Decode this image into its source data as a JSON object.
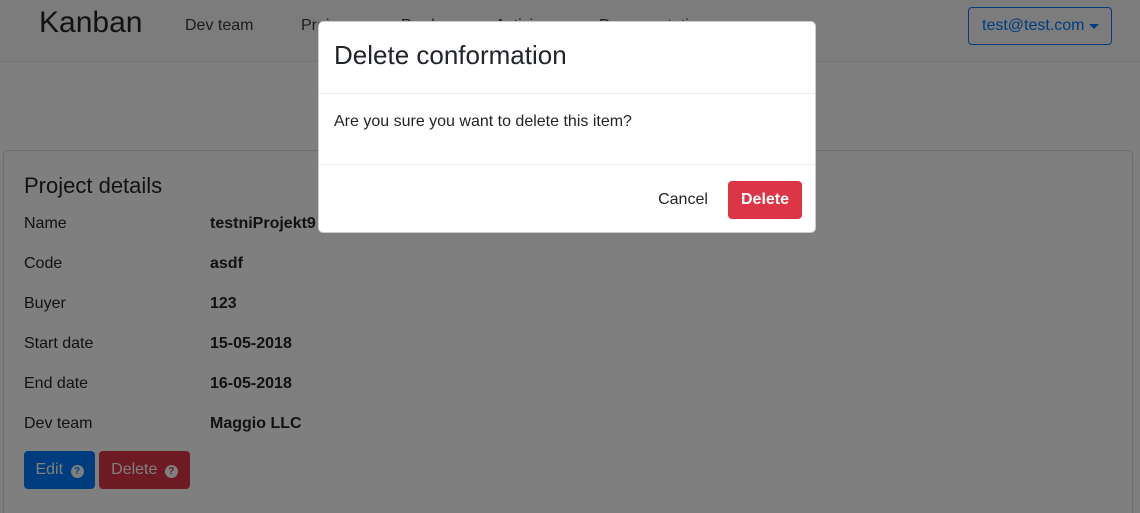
{
  "navbar": {
    "brand": "Kanban",
    "links": [
      "Dev team",
      "Proj",
      "Produ",
      "Activi",
      "Documentati"
    ],
    "user_email": "test@test.com"
  },
  "project": {
    "title": "Project details",
    "fields": [
      {
        "label": "Name",
        "value": "testniProjekt9"
      },
      {
        "label": "Code",
        "value": "asdf"
      },
      {
        "label": "Buyer",
        "value": "123"
      },
      {
        "label": "Start date",
        "value": "15-05-2018"
      },
      {
        "label": "End date",
        "value": "16-05-2018"
      },
      {
        "label": "Dev team",
        "value": "Maggio LLC"
      }
    ],
    "edit_label": "Edit",
    "delete_label": "Delete",
    "help_glyph": "?"
  },
  "modal": {
    "title": "Delete conformation",
    "message": "Are you sure you want to delete this item?",
    "cancel_label": "Cancel",
    "confirm_label": "Delete"
  },
  "colors": {
    "primary": "#007bff",
    "danger": "#dc3545",
    "backdrop": "rgba(0,0,0,0.5)"
  }
}
